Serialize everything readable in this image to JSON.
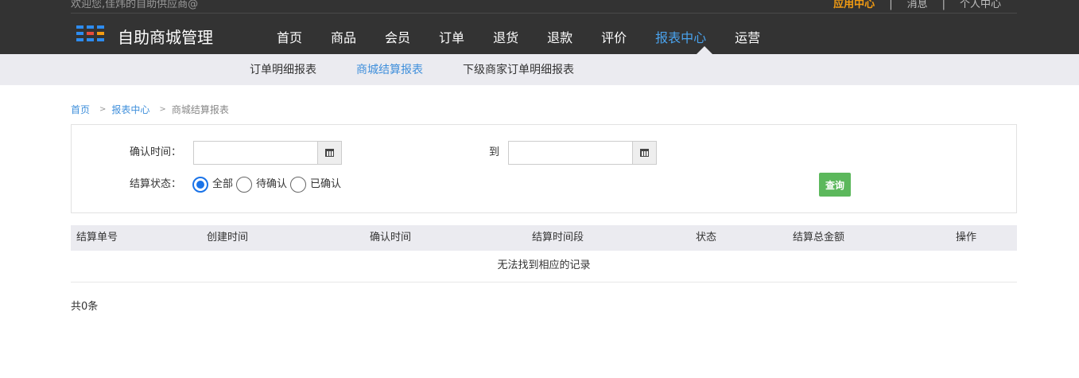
{
  "header": {
    "welcome": "欢迎您,佳炜的自助供应商@",
    "links": [
      "应用中心",
      "消息",
      "个人中心"
    ],
    "brand": "自助商城管理",
    "logo_colors": [
      "#2d8cf0",
      "#2d8cf0",
      "#2d8cf0",
      "#2d8cf0",
      "#e74c3c",
      "#f39c12",
      "#2d8cf0",
      "#2d8cf0",
      "#2d8cf0"
    ]
  },
  "nav": {
    "items": [
      "首页",
      "商品",
      "会员",
      "订单",
      "退货",
      "退款",
      "评价",
      "报表中心",
      "运营"
    ],
    "active": "报表中心"
  },
  "subnav": {
    "items": [
      "订单明细报表",
      "商城结算报表",
      "下级商家订单明细报表"
    ],
    "active": "商城结算报表"
  },
  "breadcrumb": {
    "home": "首页",
    "section": "报表中心",
    "current": "商城结算报表",
    "separator": ">"
  },
  "filters": {
    "confirm_time_label": "确认时间：",
    "to_label": "到",
    "start_date": "",
    "end_date": "",
    "status_label": "结算状态：",
    "status_options": [
      "全部",
      "待确认",
      "已确认"
    ],
    "status_selected": "全部",
    "query_button": "查询"
  },
  "table": {
    "columns": [
      "结算单号",
      "创建时间",
      "确认时间",
      "结算时间段",
      "状态",
      "结算总金额",
      "操作"
    ],
    "rows": [],
    "empty_text": "无法找到相应的记录"
  },
  "footer": {
    "total_text": "共0条"
  },
  "colors": {
    "header_bg": "#333333",
    "accent_blue": "#3f8fdb",
    "accent_orange": "#f39c12",
    "query_green": "#5cb85c",
    "subbar_bg": "#ebebf0"
  }
}
